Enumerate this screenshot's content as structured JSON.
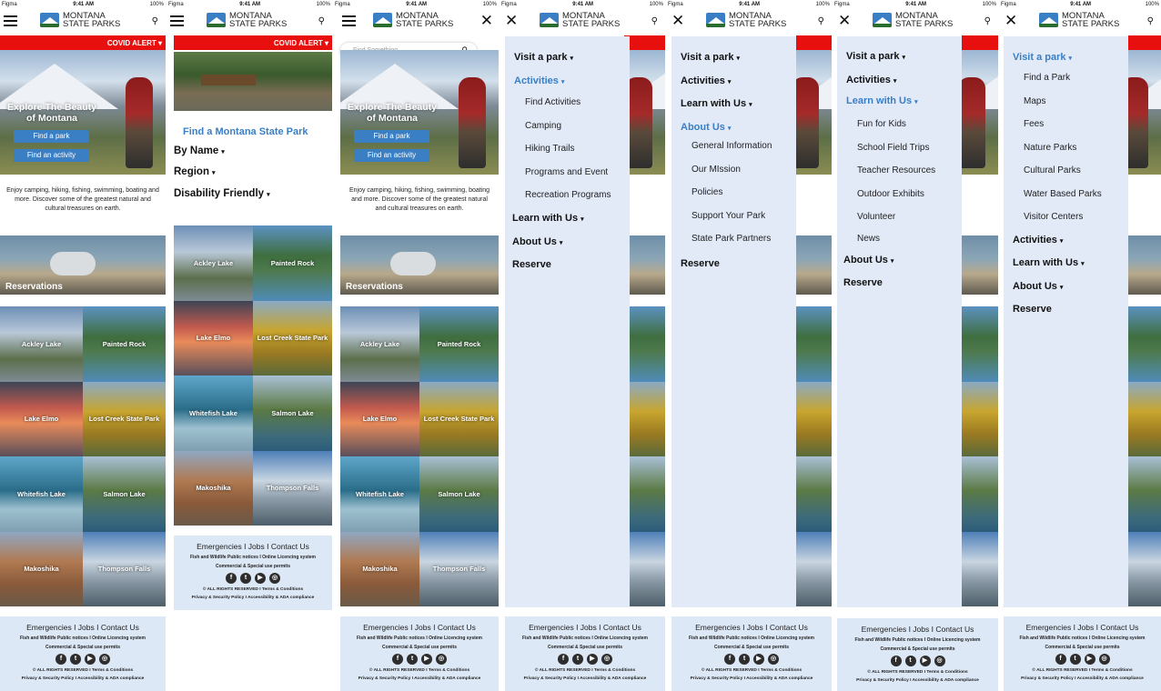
{
  "status": {
    "carrier": "Figma",
    "time": "9:41 AM",
    "battery": "100%"
  },
  "brand": {
    "line1": "MONTANA",
    "line2": "STATE PARKS"
  },
  "covid": "COVID ALERT",
  "hero": {
    "title": "Explore The Beauty of Montana",
    "btn_park": "Find a park",
    "btn_activity": "Find an activity"
  },
  "intro": "Enjoy camping, hiking, fishing, swimming, boating and more. Discover some of the greatest natural and cultural treasures on earth.",
  "reservations": "Reservations",
  "parks": [
    "Ackley Lake",
    "Painted Rock",
    "Lake Elmo",
    "Lost Creek State Park",
    "Whitefish Lake",
    "Salmon Lake",
    "Makoshika",
    "Thompson Falls"
  ],
  "search_placeholder": "Find Something",
  "find": {
    "title": "Find a Montana State Park",
    "by_name": "By Name",
    "region": "Region",
    "disability": "Disability Friendly"
  },
  "menu": {
    "visit": "Visit a park",
    "activities": "Activities",
    "learn": "Learn with Us",
    "about": "About Us",
    "reserve": "Reserve",
    "activity_items": [
      "Find Activities",
      "Camping",
      "Hiking Trails",
      "Programs and Event",
      "Recreation Programs"
    ],
    "about_items": [
      "General Information",
      "Our MIssion",
      "Policies",
      "Support Your Park",
      "State Park Partners"
    ],
    "learn_items": [
      "Fun for Kids",
      "School Field Trips",
      "Teacher Resources",
      "Outdoor Exhibits",
      "Volunteer",
      "News"
    ],
    "visit_items": [
      "Find a Park",
      "Maps",
      "Fees",
      "Nature Parks",
      "Cultural Parks",
      "Water Based Parks",
      "Visitor Centers"
    ]
  },
  "footer": {
    "links": "Emergencies  I  Jobs  I  Contact Us",
    "notices": "Fish and Wildlife Public notices   I   Online Licencing system",
    "permits": "Commercial & Special use permits",
    "rights": "© ALL RIGHTS RESERVED  I  Terms & Conditions",
    "policy": "Privacy & Security Policy  I  Accessibility & ADA compliance",
    "social": [
      "f",
      "t",
      "▶",
      "◎"
    ]
  }
}
